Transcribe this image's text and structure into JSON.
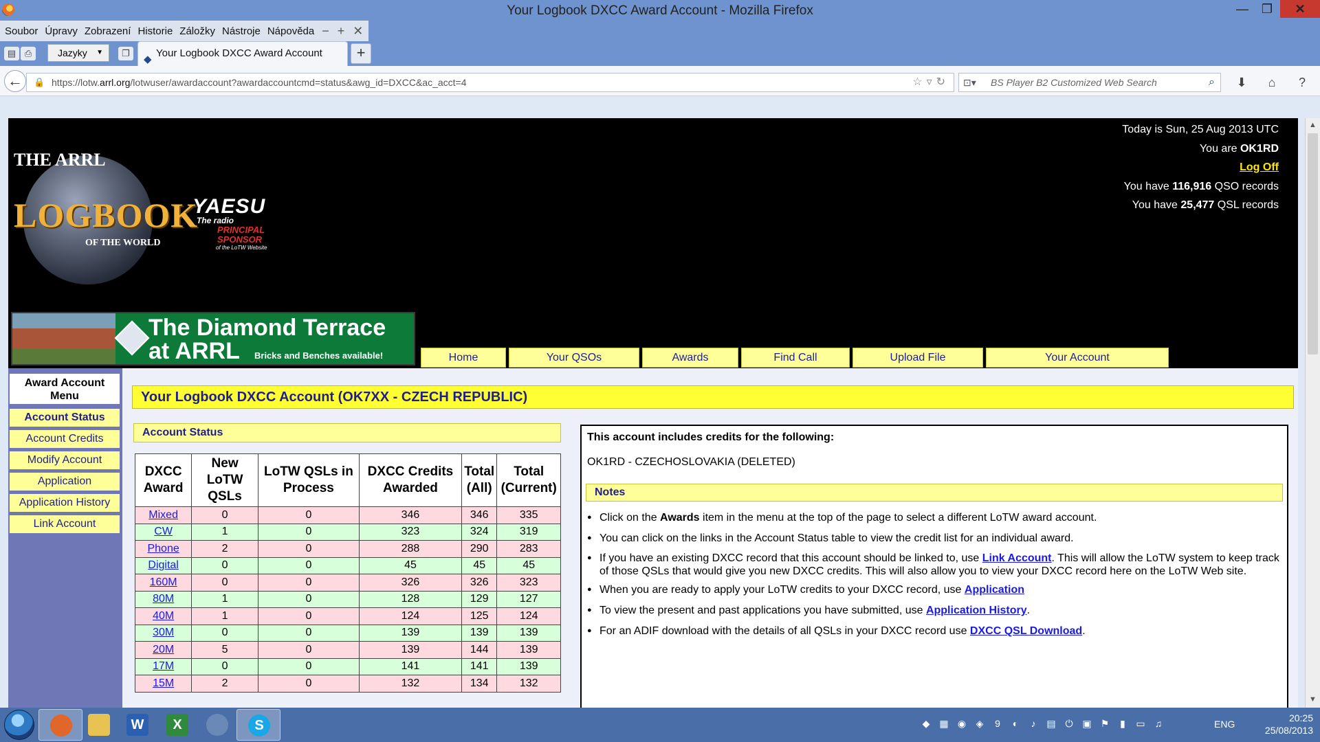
{
  "window": {
    "title": "Your Logbook DXCC Award Account - Mozilla Firefox",
    "min": "—",
    "max": "❐",
    "close": "✕"
  },
  "menu": [
    "Soubor",
    "Úpravy",
    "Zobrazení",
    "Historie",
    "Záložky",
    "Nástroje",
    "Nápověda"
  ],
  "toolbar": {
    "language_dropdown": "Jazyky"
  },
  "tab": {
    "title": "Your Logbook DXCC Award Account",
    "new_tab": "+"
  },
  "url": {
    "prefix": "https://lotw.",
    "domain": "arrl.org",
    "path": "/lotwuser/awardaccount?awardaccountcmd=status&awg_id=DXCC&ac_acct=4"
  },
  "search": {
    "placeholder": "BS Player B2 Customized Web Search"
  },
  "banner": {
    "logo_top": "THE ARRL",
    "logo_main": "LOGBOOK",
    "logo_bottom": "OF THE WORLD",
    "sponsor_brand": "YAESU",
    "sponsor_tagline": "The radio",
    "sponsor_role_1": "PRINCIPAL",
    "sponsor_role_2": "SPONSOR",
    "sponsor_note": "of the LoTW Website",
    "promo_line1": "The Diamond Terrace",
    "promo_line2": "at ARRL",
    "promo_line3": "Bricks and Benches available!"
  },
  "user": {
    "today": "Today is Sun, 25 Aug 2013 UTC",
    "you_are_prefix": "You are ",
    "callsign": "OK1RD",
    "logoff": "Log Off",
    "qso_prefix": "You have ",
    "qso_count": "116,916",
    "qso_suffix": " QSO records",
    "qsl_prefix": "You have ",
    "qsl_count": "25,477",
    "qsl_suffix": " QSL records"
  },
  "top_nav": [
    "Home",
    "Your QSOs",
    "Awards",
    "Find Call",
    "Upload File",
    "Your Account"
  ],
  "left_menu": {
    "header": "Award Account Menu",
    "items": [
      "Account Status",
      "Account Credits",
      "Modify Account",
      "Application",
      "Application History",
      "Link Account"
    ]
  },
  "page_title": "Your Logbook DXCC Account (OK7XX - CZECH REPUBLIC)",
  "status_header": "Account Status",
  "table": {
    "headers": [
      "DXCC Award",
      "New LoTW QSLs",
      "LoTW QSLs in Process",
      "DXCC Credits Awarded",
      "Total (All)",
      "Total (Current)"
    ],
    "rows": [
      [
        "Mixed",
        "0",
        "0",
        "346",
        "346",
        "335"
      ],
      [
        "CW",
        "1",
        "0",
        "323",
        "324",
        "319"
      ],
      [
        "Phone",
        "2",
        "0",
        "288",
        "290",
        "283"
      ],
      [
        "Digital",
        "0",
        "0",
        "45",
        "45",
        "45"
      ],
      [
        "160M",
        "0",
        "0",
        "326",
        "326",
        "323"
      ],
      [
        "80M",
        "1",
        "0",
        "128",
        "129",
        "127"
      ],
      [
        "40M",
        "1",
        "0",
        "124",
        "125",
        "124"
      ],
      [
        "30M",
        "0",
        "0",
        "139",
        "139",
        "139"
      ],
      [
        "20M",
        "5",
        "0",
        "139",
        "144",
        "139"
      ],
      [
        "17M",
        "0",
        "0",
        "141",
        "141",
        "139"
      ],
      [
        "15M",
        "2",
        "0",
        "132",
        "134",
        "132"
      ]
    ]
  },
  "info": {
    "header": "This account includes credits for the following:",
    "linked": "OK1RD - CZECHOSLOVAKIA (DELETED)",
    "notes_title": "Notes",
    "notes": [
      {
        "pre": "Click on the ",
        "bold": "Awards",
        "post": " item in the menu at the top of the page to select a different LoTW award account."
      },
      {
        "pre": "You can click on the links in the Account Status table to view the credit list for an individual award."
      },
      {
        "pre": " If you have an existing DXCC record that this account should be linked to, use ",
        "link": "Link Account",
        "post": ". This will allow the LoTW system to keep track of those QSLs that would give you new DXCC credits. This will also allow you to view your DXCC record here on the LoTW Web site."
      },
      {
        "pre": "When you are ready to apply your LoTW credits to your DXCC record, use ",
        "link": "Application",
        "post": ""
      },
      {
        "pre": "To view the present and past applications you have submitted, use ",
        "link": "Application History",
        "post": "."
      },
      {
        "pre": "For an ADIF download with the details of all QSLs in your DXCC record use ",
        "link": "DXCC QSL Download",
        "post": "."
      }
    ]
  },
  "taskbar": {
    "apps": [
      {
        "name": "firefox",
        "glyph": "",
        "color": "#e0662a",
        "active": true
      },
      {
        "name": "explorer",
        "glyph": "",
        "color": "#e8c352",
        "active": false
      },
      {
        "name": "word",
        "glyph": "W",
        "color": "#2b5fb1",
        "active": false
      },
      {
        "name": "excel",
        "glyph": "X",
        "color": "#2f8a3e",
        "active": false
      },
      {
        "name": "thunderbird",
        "glyph": "",
        "color": "#6b89b6",
        "active": false
      },
      {
        "name": "skype",
        "glyph": "S",
        "color": "#1aa7e6",
        "active": true
      }
    ],
    "tray_glyphs": [
      "◆",
      "▦",
      "◉",
      "◈",
      "9",
      "◐",
      "♪",
      "▤",
      "⏻",
      "▣",
      "⚑",
      "▮",
      "▭",
      "♫"
    ],
    "lang": "ENG",
    "time": "20:25",
    "date": "25/08/2013"
  }
}
